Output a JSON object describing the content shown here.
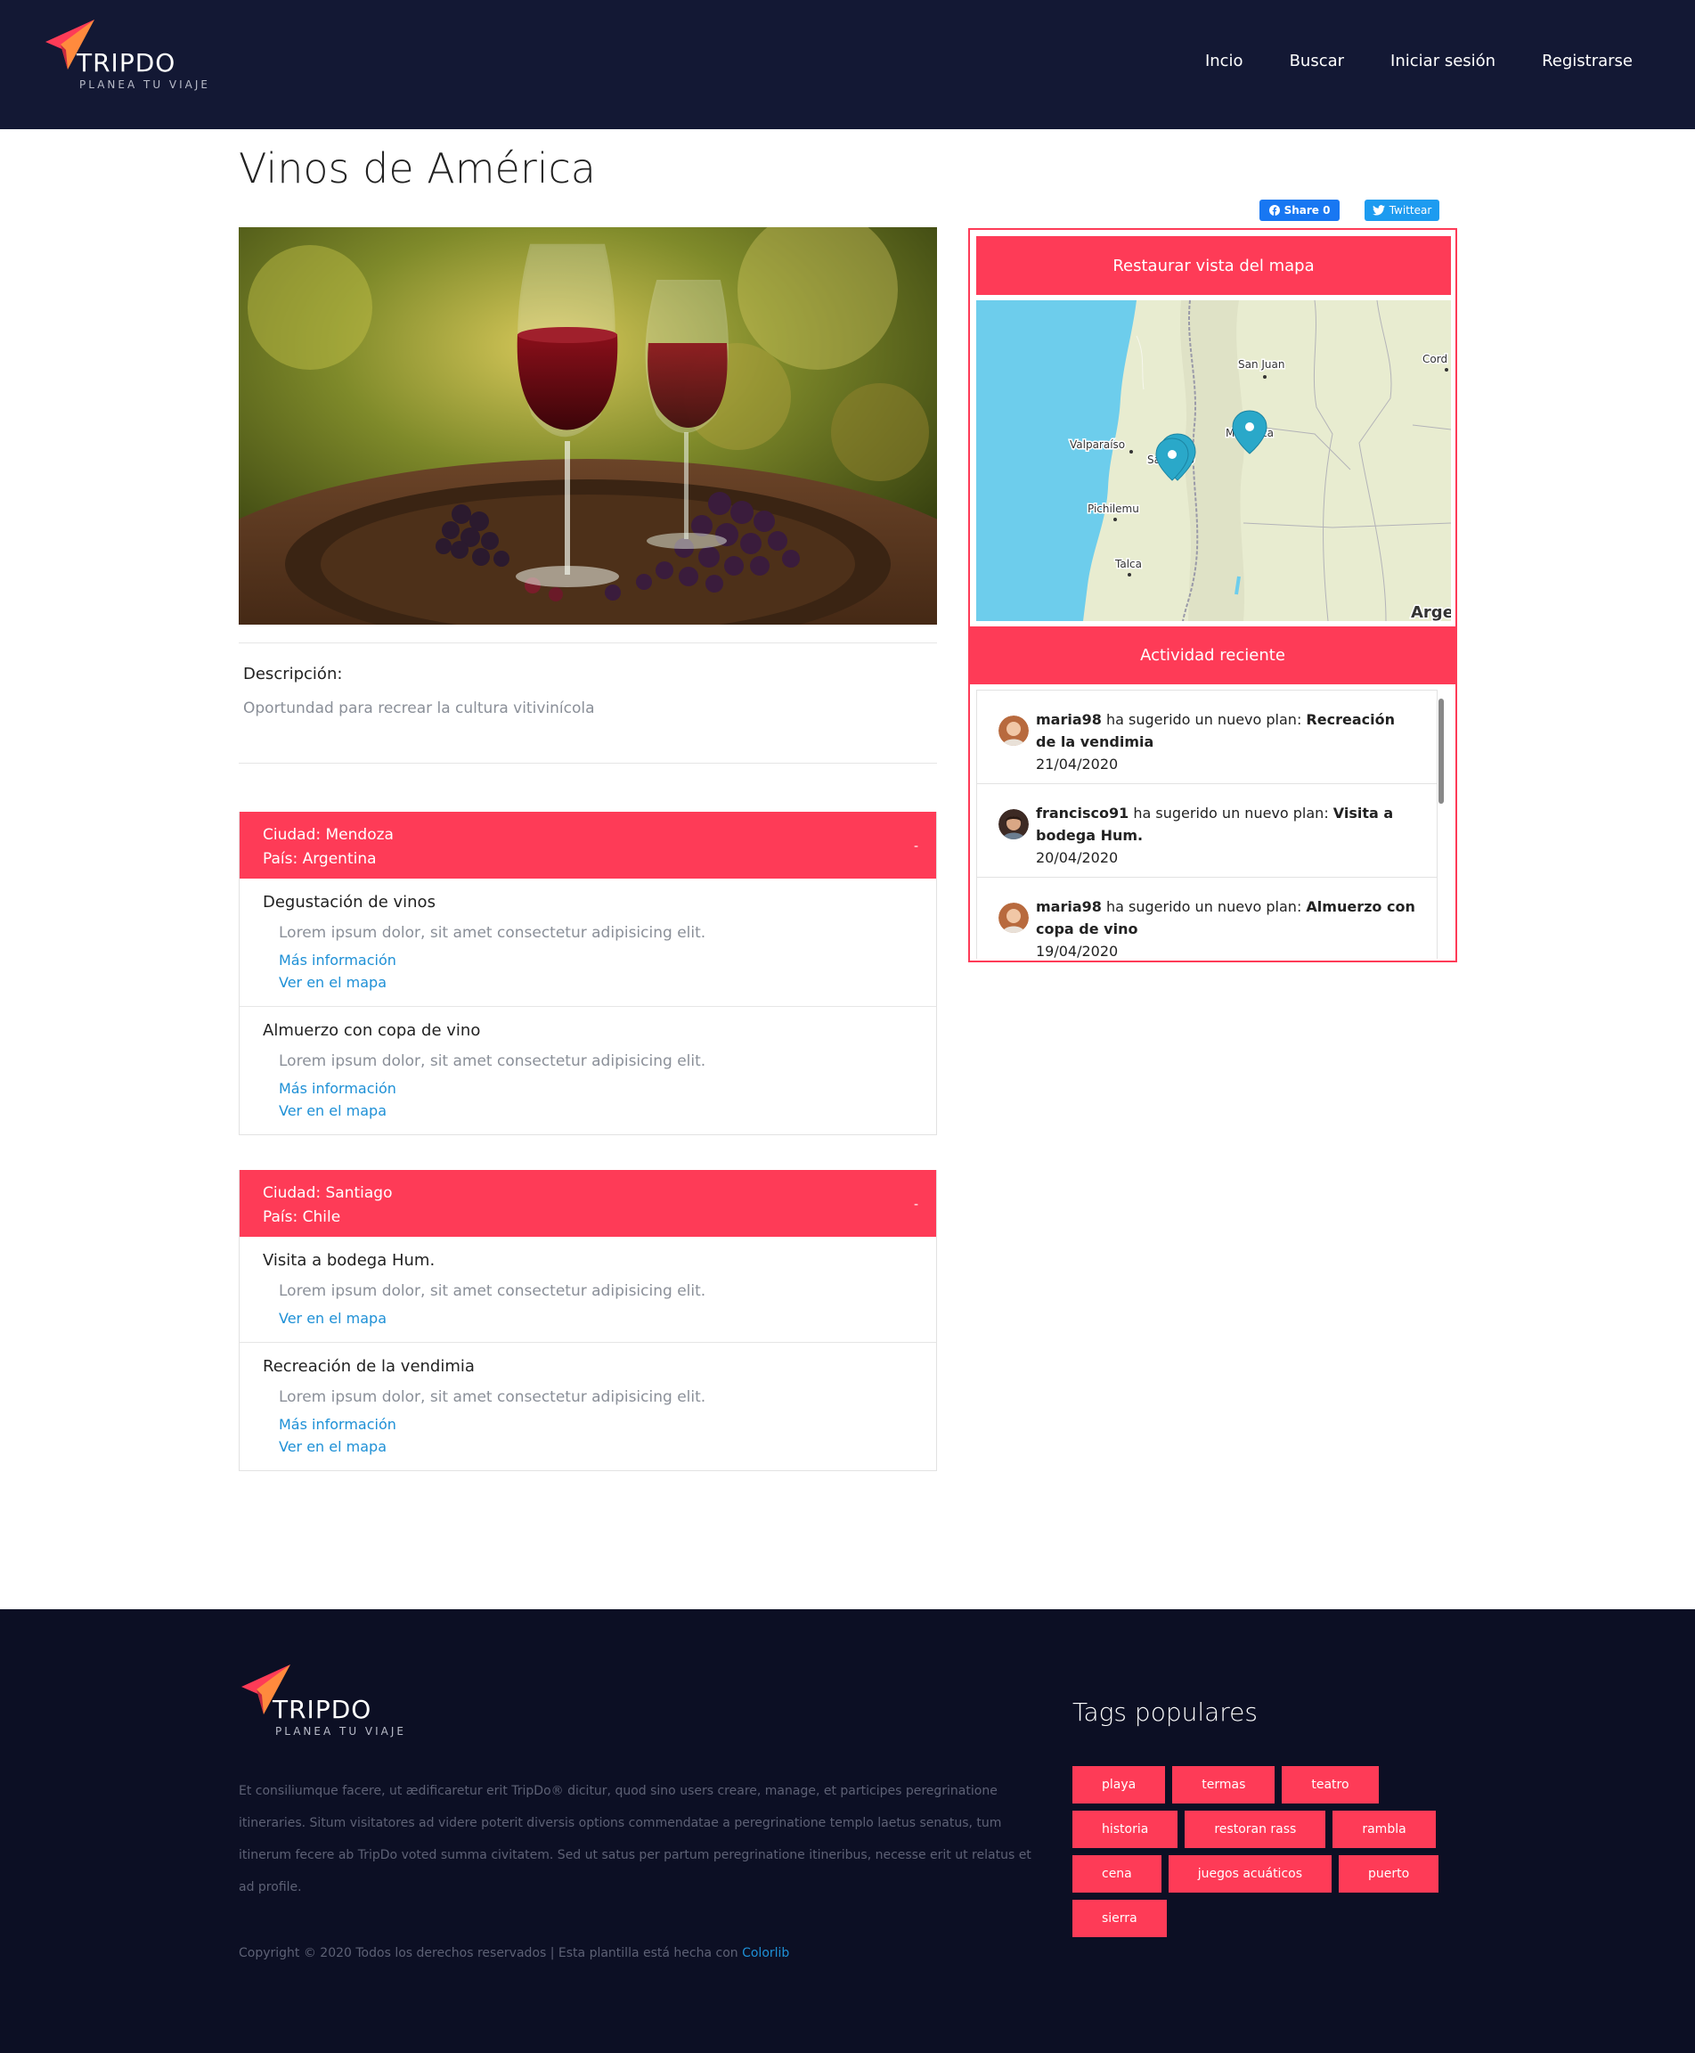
{
  "header": {
    "logo_text": "TRIPDO",
    "logo_sub": "PLANEA TU VIAJE",
    "nav": [
      {
        "label": "Incio"
      },
      {
        "label": "Buscar"
      },
      {
        "label": "Iniciar sesión"
      },
      {
        "label": "Registrarse"
      }
    ]
  },
  "main": {
    "title": "Vinos de América",
    "share": {
      "facebook": "Share 0",
      "twitter": "Twittear"
    },
    "description_label": "Descripción:",
    "description": "Oportundad para recrear la cultura vitivinícola"
  },
  "cities": [
    {
      "city": "Ciudad: Mendoza",
      "country": "País: Argentina",
      "toggle": "-",
      "plans": [
        {
          "title": "Degustación de vinos",
          "text": "Lorem ipsum dolor, sit amet consectetur adipisicing elit.",
          "more": "Más información",
          "map": "Ver en el mapa"
        },
        {
          "title": "Almuerzo con copa de vino",
          "text": "Lorem ipsum dolor, sit amet consectetur adipisicing elit.",
          "more": "Más información",
          "map": "Ver en el mapa"
        }
      ]
    },
    {
      "city": "Ciudad: Santiago",
      "country": "País: Chile",
      "toggle": "-",
      "plans": [
        {
          "title": "Visita a bodega Hum.",
          "text": "Lorem ipsum dolor, sit amet consectetur adipisicing elit.",
          "map": "Ver en el mapa"
        },
        {
          "title": "Recreación de la vendimia",
          "text": "Lorem ipsum dolor, sit amet consectetur adipisicing elit.",
          "more": "Más información",
          "map": "Ver en el mapa"
        }
      ]
    }
  ],
  "side": {
    "restore_button": "Restaurar vista del mapa",
    "map_labels": {
      "san_juan": "San Juan",
      "cordoba": "Cord",
      "valparaiso": "Valparaíso",
      "santiago": "Santiago",
      "mendoza": "Mendoza",
      "pichilemu": "Pichilemu",
      "talca": "Talca",
      "argentina": "Arge"
    },
    "activity_title": "Actividad reciente",
    "activity": [
      {
        "user": "maria98",
        "verb": " ha sugerido un nuevo plan: ",
        "plan": "Recreación de la vendimia",
        "date": "21/04/2020"
      },
      {
        "user": "francisco91",
        "verb": " ha sugerido un nuevo plan: ",
        "plan": "Visita a bodega Hum.",
        "date": "20/04/2020"
      },
      {
        "user": "maria98",
        "verb": " ha sugerido un nuevo plan: ",
        "plan": "Almuerzo con copa de vino",
        "date": "19/04/2020"
      }
    ]
  },
  "footer": {
    "logo_text": "TRIPDO",
    "logo_sub": "PLANEA TU VIAJE",
    "about": "Et consiliumque facere, ut ædificaretur erit TripDo® dicitur, quod sino users creare, manage, et participes peregrinatione itineraries. Situm visitatores ad videre poterit diversis options commendatae a peregrinatione templo laetus senatus, tum itinerum fecere ab TripDo voted summa civitatem. Sed ut satus per partum peregrinatione itineribus, necesse erit ut relatus et ad profile.",
    "copyright": "Copyright © 2020 Todos los derechos reservados | Esta plantilla está hecha con ",
    "credit_link": "Colorlib",
    "tags_title": "Tags populares",
    "tags": [
      "playa",
      "termas",
      "teatro",
      "historia",
      "restoran rass",
      "rambla",
      "cena",
      "juegos acuáticos",
      "puerto",
      "sierra"
    ]
  },
  "colors": {
    "header_bg": "#131834",
    "footer_bg": "#0c0f24",
    "accent": "#fe3b57",
    "link": "#1e90d6"
  }
}
